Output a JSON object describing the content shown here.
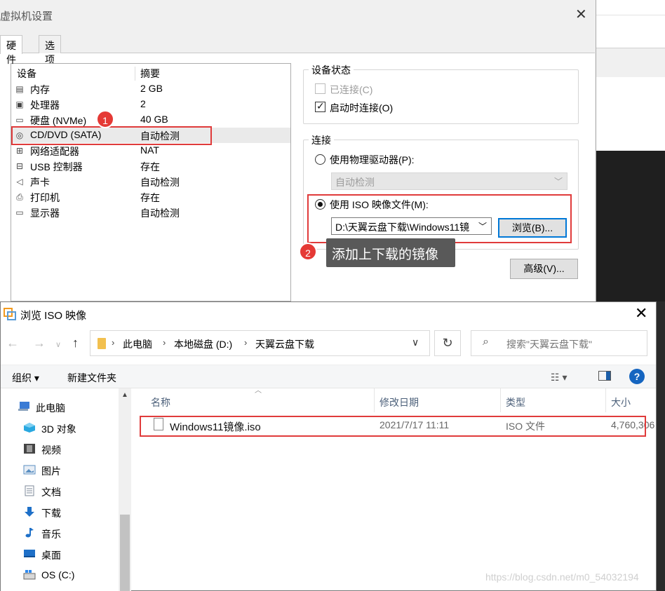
{
  "vm_dialog": {
    "title": "虚拟机设置",
    "close_glyph": "✕",
    "tabs": [
      "硬件",
      "选项"
    ],
    "device_header": {
      "device": "设备",
      "summary": "摘要"
    },
    "devices": [
      {
        "icon": "memory-icon",
        "glyph": "▤",
        "name": "内存",
        "summary": "2 GB"
      },
      {
        "icon": "cpu-icon",
        "glyph": "▣",
        "name": "处理器",
        "summary": "2"
      },
      {
        "icon": "disk-icon",
        "glyph": "▭",
        "name": "硬盘 (NVMe)",
        "summary": "40 GB"
      },
      {
        "icon": "cd-icon",
        "glyph": "◎",
        "name": "CD/DVD (SATA)",
        "summary": "自动检测"
      },
      {
        "icon": "network-icon",
        "glyph": "⊞",
        "name": "网络适配器",
        "summary": "NAT"
      },
      {
        "icon": "usb-icon",
        "glyph": "⊟",
        "name": "USB 控制器",
        "summary": "存在"
      },
      {
        "icon": "sound-icon",
        "glyph": "◁",
        "name": "声卡",
        "summary": "自动检测"
      },
      {
        "icon": "printer-icon",
        "glyph": "⎙",
        "name": "打印机",
        "summary": "存在"
      },
      {
        "icon": "display-icon",
        "glyph": "▭",
        "name": "显示器",
        "summary": "自动检测"
      }
    ],
    "selected_device": "CD/DVD (SATA)",
    "device_status": {
      "title": "设备状态",
      "connected": {
        "label": "已连接(C)",
        "checked": false,
        "disabled": true
      },
      "connect_on_start": {
        "label": "启动时连接(O)",
        "checked": true
      }
    },
    "connection": {
      "title": "连接",
      "physical_drive": {
        "label": "使用物理驱动器(P):",
        "selected": false
      },
      "physical_drive_value": "自动检测",
      "iso_image": {
        "label": "使用 ISO 映像文件(M):",
        "selected": true
      },
      "iso_path": "D:\\天翼云盘下载\\Windows11镜",
      "browse_button": "浏览(B)..."
    },
    "advanced_button": "高级(V)...",
    "badge1": "1",
    "badge2": "2",
    "tooltip": "添加上下载的镜像"
  },
  "iso_dialog": {
    "title": "浏览 ISO 映像",
    "close_glyph": "✕",
    "breadcrumb": [
      "此电脑",
      "本地磁盘 (D:)",
      "天翼云盘下载"
    ],
    "search_placeholder": "搜索\"天翼云盘下载\"",
    "toolbar": {
      "organize": "组织 ▾",
      "new_folder": "新建文件夹",
      "help": "?"
    },
    "nav_items": [
      {
        "icon": "this-pc-icon",
        "label": "此电脑",
        "color": "#3a7bd5"
      },
      {
        "icon": "3d-objects-icon",
        "label": "3D 对象",
        "color": "#29a8e0"
      },
      {
        "icon": "videos-icon",
        "label": "视频",
        "color": "#444444"
      },
      {
        "icon": "pictures-icon",
        "label": "图片",
        "color": "#5a8fc2"
      },
      {
        "icon": "documents-icon",
        "label": "文档",
        "color": "#7d8a99"
      },
      {
        "icon": "downloads-icon",
        "label": "下载",
        "color": "#1e70c8"
      },
      {
        "icon": "music-icon",
        "label": "音乐",
        "color": "#1e70c8"
      },
      {
        "icon": "desktop-icon",
        "label": "桌面",
        "color": "#1e70c8"
      },
      {
        "icon": "drive-c-icon",
        "label": "OS (C:)",
        "color": "#666666"
      }
    ],
    "columns": [
      "名称",
      "修改日期",
      "类型",
      "大小"
    ],
    "files": [
      {
        "name": "Windows11镜像.iso",
        "modified": "2021/7/17 11:11",
        "type": "ISO 文件",
        "size": "4,760,306"
      }
    ]
  },
  "watermark": "https://blog.csdn.net/m0_54032194",
  "colors": {
    "highlight_red": "#e03b3b",
    "badge_red": "#e53935",
    "focus_blue": "#0078d7"
  }
}
